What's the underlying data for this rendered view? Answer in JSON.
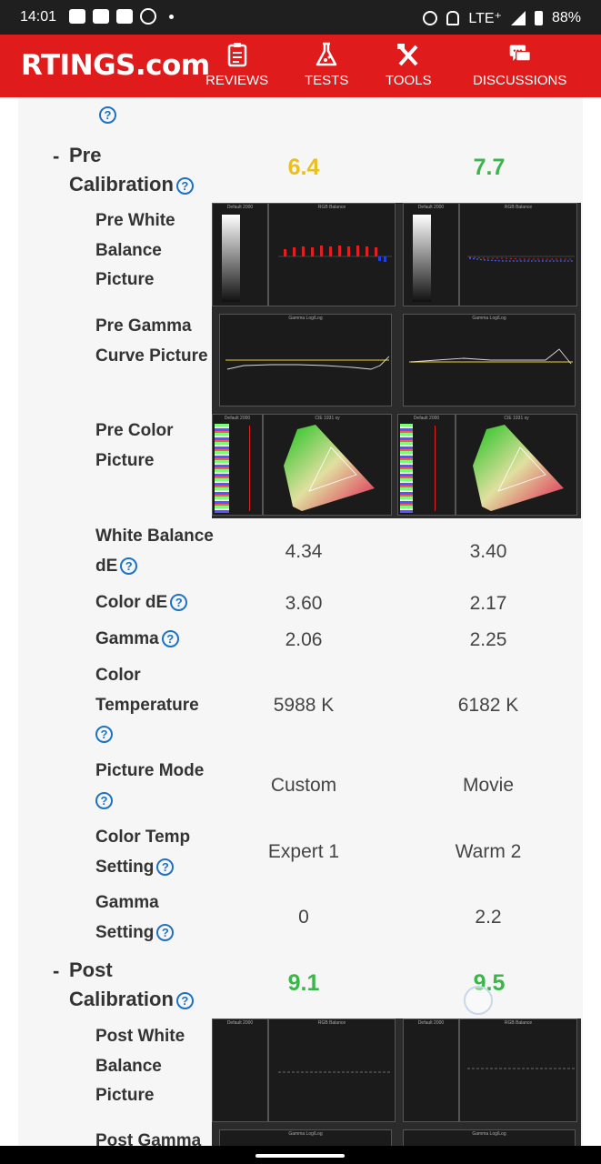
{
  "status_bar": {
    "time": "14:01",
    "network": "LTE⁺",
    "battery": "88%",
    "left_icons": [
      "photos-icon",
      "youtube-icon",
      "youtube-icon",
      "smiley-icon",
      "dot-icon"
    ],
    "right_icons": [
      "alarm-icon",
      "mute-icon",
      "signal-icon",
      "battery-icon"
    ]
  },
  "nav": {
    "logo": "RTINGS.com",
    "items": [
      {
        "label": "REVIEWS",
        "icon": "clipboard-icon"
      },
      {
        "label": "TESTS",
        "icon": "flask-icon"
      },
      {
        "label": "TOOLS",
        "icon": "tools-icon"
      },
      {
        "label": "DISCUSSIONS",
        "icon": "chat-icon"
      }
    ],
    "color": "#e01b1b"
  },
  "colors": {
    "yellow_score": "#e8c020",
    "green_score": "#3cb54a",
    "help_blue": "#1d72c4"
  },
  "pre_calibration": {
    "dash": "-",
    "title_line1": "Pre",
    "title_line2": "Calibration",
    "score_left": "6.4",
    "score_right": "7.7",
    "rows": {
      "white_balance_picture": "Pre White Balance Picture",
      "gamma_curve_picture": "Pre Gamma Curve Picture",
      "color_picture": "Pre Color Picture",
      "white_balance_de": {
        "label": "White Balance dE",
        "left": "4.34",
        "right": "3.40"
      },
      "color_de": {
        "label": "Color dE",
        "left": "3.60",
        "right": "2.17"
      },
      "gamma": {
        "label": "Gamma",
        "left": "2.06",
        "right": "2.25"
      },
      "color_temperature": {
        "label": "Color Temperature",
        "left": "5988 K",
        "right": "6182 K"
      },
      "picture_mode": {
        "label": "Picture Mode",
        "left": "Custom",
        "right": "Movie"
      },
      "color_temp_setting": {
        "label": "Color Temp Setting",
        "left": "Expert 1",
        "right": "Warm 2"
      },
      "gamma_setting": {
        "label": "Gamma Setting",
        "left": "0",
        "right": "2.2"
      }
    }
  },
  "post_calibration": {
    "dash": "-",
    "title_line1": "Post",
    "title_line2": "Calibration",
    "score_left": "9.1",
    "score_right": "9.5",
    "rows": {
      "white_balance_picture": "Post White Balance Picture",
      "gamma_curve_picture_partial": "Post Gamma"
    }
  },
  "graph_titles": {
    "default": "Default 2000",
    "rgb": "RGB Balance",
    "gamma": "Gamma Log/Log",
    "cie": "CIE 1931 xy"
  }
}
